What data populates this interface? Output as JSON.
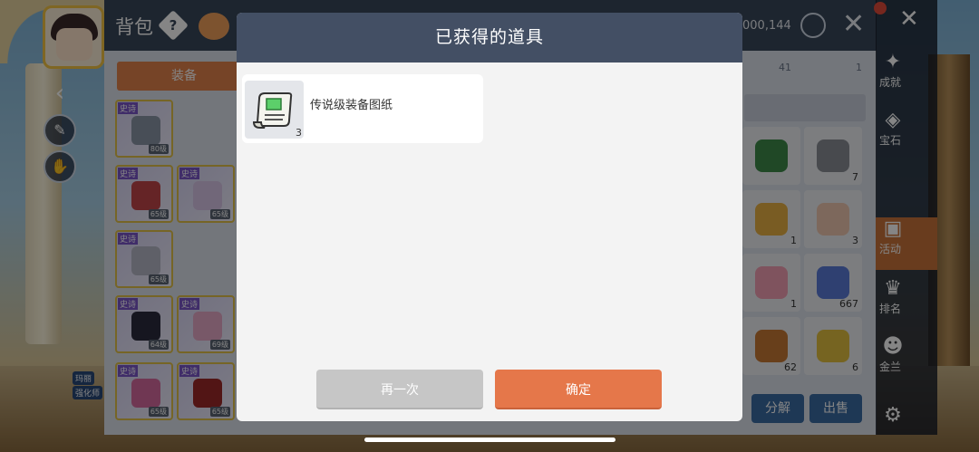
{
  "inventory": {
    "title": "背包",
    "help_icon": "diamond-question-icon",
    "meso_value": "000,144",
    "close_glyph": "✕",
    "tab_equipment": "装备",
    "categories": [
      {
        "icon": "briefcase-icon",
        "count": "41"
      },
      {
        "icon": "flower-icon",
        "count": "1"
      }
    ],
    "equip_slots": [
      {
        "badge": "史诗",
        "level": "80级",
        "color": "#8b96a8"
      },
      {
        "badge": "史诗",
        "level": "65级",
        "color": "#c2454a"
      },
      {
        "badge": "史诗",
        "level": "65级",
        "color": "#d9c6e8"
      },
      {
        "badge": "史诗",
        "level": "65级",
        "color": "#b7b9c8"
      },
      {
        "badge": "史诗",
        "level": "64级",
        "color": "#2b2b3e"
      },
      {
        "badge": "史诗",
        "level": "69级",
        "color": "#e7a9c7"
      },
      {
        "badge": "史诗",
        "level": "65级",
        "color": "#d66aa0"
      },
      {
        "badge": "史诗",
        "level": "65级",
        "color": "#9e2a2a"
      }
    ],
    "right_slots": [
      {
        "count": "",
        "color": "#3e8a4a"
      },
      {
        "count": "7",
        "color": "#8a8f96"
      },
      {
        "count": "1",
        "color": "#e8b043"
      },
      {
        "count": "3",
        "color": "#f0c8b0"
      },
      {
        "count": "1",
        "color": "#f4a0b4"
      },
      {
        "count": "667",
        "color": "#5a7bd8"
      },
      {
        "count": "62",
        "color": "#c77a35"
      },
      {
        "count": "6",
        "color": "#e2c040"
      }
    ],
    "btn_disassemble": "分解",
    "btn_sell": "出售"
  },
  "side_menu": [
    {
      "icon": "maple-leaf-icon",
      "label": "成就"
    },
    {
      "icon": "gem-icon",
      "label": "宝石"
    },
    {
      "icon": "calendar-icon",
      "label": "活动"
    },
    {
      "icon": "trophy-icon",
      "label": "排名"
    },
    {
      "icon": "masks-icon",
      "label": "金兰"
    }
  ],
  "hud": {
    "tag_1": "玛丽",
    "tag_2": "强化师"
  },
  "modal": {
    "title": "已获得的道具",
    "item": {
      "name": "传说级装备图纸",
      "count": "3",
      "icon": "scroll-blueprint-icon"
    },
    "btn_retry": "再一次",
    "btn_confirm": "确定"
  },
  "colors": {
    "modal_header": "#434f64",
    "confirm": "#e5774a",
    "retry": "#c6c6c6",
    "epic_badge": "#7b56c9"
  }
}
